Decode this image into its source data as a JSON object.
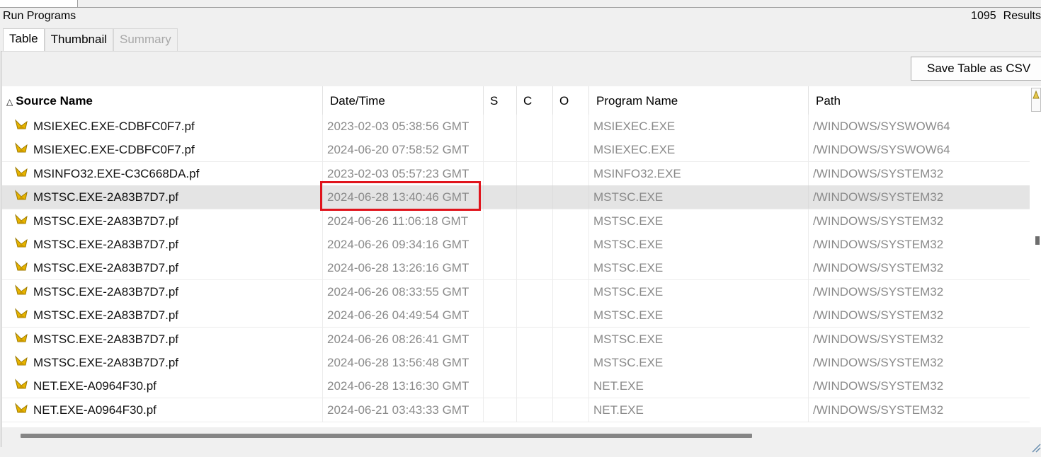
{
  "window": {
    "title": "Run Programs",
    "result_count": "1095",
    "result_label": "Results"
  },
  "tabs": [
    {
      "label": "Table",
      "active": true
    },
    {
      "label": "Thumbnail",
      "active": false
    },
    {
      "label": "Summary",
      "active": false,
      "disabled": true
    }
  ],
  "toolbar": {
    "save_csv_label": "Save Table as CSV"
  },
  "table": {
    "columns": [
      "Source Name",
      "Date/Time",
      "S",
      "C",
      "O",
      "Program Name",
      "Path"
    ],
    "sorted_column": "Source Name",
    "sort_direction": "ascending",
    "selected_row": 3,
    "highlighted_cell": {
      "row": 3,
      "column": "Date/Time",
      "color": "#e0141c"
    },
    "rows": [
      {
        "source": "MSIEXEC.EXE-CDBFC0F7.pf",
        "datetime": "2023-02-03 05:38:56 GMT",
        "s": "",
        "c": "",
        "o": "",
        "program": "MSIEXEC.EXE",
        "path": "/WINDOWS/SYSWOW64"
      },
      {
        "source": "MSIEXEC.EXE-CDBFC0F7.pf",
        "datetime": "2024-06-20 07:58:52 GMT",
        "s": "",
        "c": "",
        "o": "",
        "program": "MSIEXEC.EXE",
        "path": "/WINDOWS/SYSWOW64"
      },
      {
        "source": "MSINFO32.EXE-C3C668DA.pf",
        "datetime": "2023-02-03 05:57:23 GMT",
        "s": "",
        "c": "",
        "o": "",
        "program": "MSINFO32.EXE",
        "path": "/WINDOWS/SYSTEM32"
      },
      {
        "source": "MSTSC.EXE-2A83B7D7.pf",
        "datetime": "2024-06-28 13:40:46 GMT",
        "s": "",
        "c": "",
        "o": "",
        "program": "MSTSC.EXE",
        "path": "/WINDOWS/SYSTEM32"
      },
      {
        "source": "MSTSC.EXE-2A83B7D7.pf",
        "datetime": "2024-06-26 11:06:18 GMT",
        "s": "",
        "c": "",
        "o": "",
        "program": "MSTSC.EXE",
        "path": "/WINDOWS/SYSTEM32"
      },
      {
        "source": "MSTSC.EXE-2A83B7D7.pf",
        "datetime": "2024-06-26 09:34:16 GMT",
        "s": "",
        "c": "",
        "o": "",
        "program": "MSTSC.EXE",
        "path": "/WINDOWS/SYSTEM32"
      },
      {
        "source": "MSTSC.EXE-2A83B7D7.pf",
        "datetime": "2024-06-28 13:26:16 GMT",
        "s": "",
        "c": "",
        "o": "",
        "program": "MSTSC.EXE",
        "path": "/WINDOWS/SYSTEM32"
      },
      {
        "source": "MSTSC.EXE-2A83B7D7.pf",
        "datetime": "2024-06-26 08:33:55 GMT",
        "s": "",
        "c": "",
        "o": "",
        "program": "MSTSC.EXE",
        "path": "/WINDOWS/SYSTEM32"
      },
      {
        "source": "MSTSC.EXE-2A83B7D7.pf",
        "datetime": "2024-06-26 04:49:54 GMT",
        "s": "",
        "c": "",
        "o": "",
        "program": "MSTSC.EXE",
        "path": "/WINDOWS/SYSTEM32"
      },
      {
        "source": "MSTSC.EXE-2A83B7D7.pf",
        "datetime": "2024-06-26 08:26:41 GMT",
        "s": "",
        "c": "",
        "o": "",
        "program": "MSTSC.EXE",
        "path": "/WINDOWS/SYSTEM32"
      },
      {
        "source": "MSTSC.EXE-2A83B7D7.pf",
        "datetime": "2024-06-28 13:56:48 GMT",
        "s": "",
        "c": "",
        "o": "",
        "program": "MSTSC.EXE",
        "path": "/WINDOWS/SYSTEM32"
      },
      {
        "source": "NET.EXE-A0964F30.pf",
        "datetime": "2024-06-28 13:16:30 GMT",
        "s": "",
        "c": "",
        "o": "",
        "program": "NET.EXE",
        "path": "/WINDOWS/SYSTEM32"
      },
      {
        "source": "NET.EXE-A0964F30.pf",
        "datetime": "2024-06-21 03:43:33 GMT",
        "s": "",
        "c": "",
        "o": "",
        "program": "NET.EXE",
        "path": "/WINDOWS/SYSTEM32"
      }
    ]
  },
  "icons": {
    "file": "prefetch-file-icon",
    "column_picker": "column-picker-icon"
  },
  "colors": {
    "icon_yellow": "#e8b400",
    "highlight_red": "#e0141c",
    "selected_row": "#e4e4e4",
    "muted_text": "#8a8a8a"
  }
}
